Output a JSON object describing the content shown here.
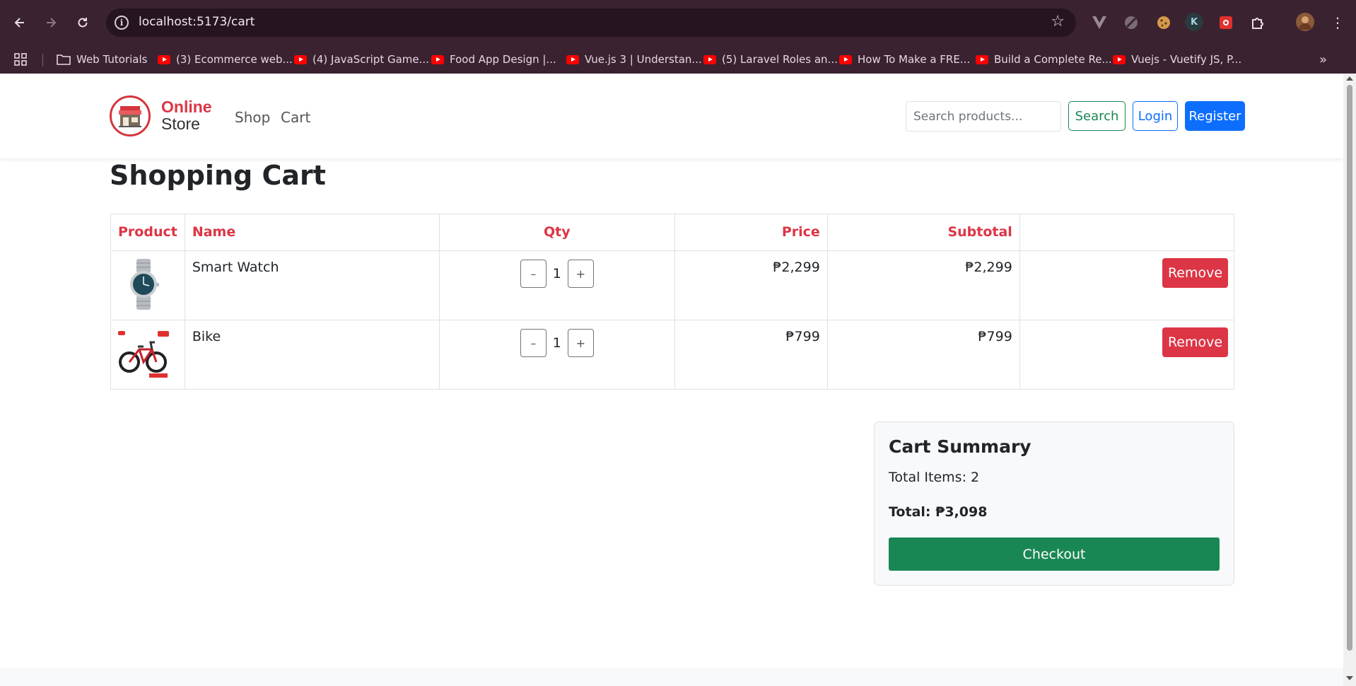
{
  "browser": {
    "url": "localhost:5173/cart",
    "bookmarks": [
      {
        "label": "Web Tutorials",
        "icon": "folder-icon"
      },
      {
        "label": "(3) Ecommerce web...",
        "icon": "youtube-icon"
      },
      {
        "label": "(4) JavaScript Game...",
        "icon": "youtube-icon"
      },
      {
        "label": "Food App Design |...",
        "icon": "youtube-icon"
      },
      {
        "label": "Vue.js 3 | Understan...",
        "icon": "youtube-icon"
      },
      {
        "label": "(5) Laravel Roles an...",
        "icon": "youtube-icon"
      },
      {
        "label": "How To Make a FRE...",
        "icon": "youtube-icon"
      },
      {
        "label": "Build a Complete Re...",
        "icon": "youtube-icon"
      },
      {
        "label": "Vuejs - Vuetify JS, P...",
        "icon": "youtube-icon"
      }
    ],
    "extension_k": "K"
  },
  "navbar": {
    "brand_line1": "Online",
    "brand_line2": "Store",
    "links": [
      "Shop",
      "Cart"
    ],
    "search_placeholder": "Search products...",
    "search_label": "Search",
    "login_label": "Login",
    "register_label": "Register"
  },
  "cart": {
    "title": "Shopping Cart",
    "columns": [
      "Product",
      "Name",
      "Qty",
      "Price",
      "Subtotal"
    ],
    "minus_label": "–",
    "plus_label": "+",
    "remove_label": "Remove",
    "items": [
      {
        "name": "Smart Watch",
        "qty": "1",
        "price": "₱2,299",
        "subtotal": "₱2,299",
        "image": "watch-image"
      },
      {
        "name": "Bike",
        "qty": "1",
        "price": "₱799",
        "subtotal": "₱799",
        "image": "bike-image"
      }
    ]
  },
  "summary": {
    "title": "Cart Summary",
    "total_items": "Total Items: 2",
    "total": "Total: ₱3,098",
    "checkout_label": "Checkout"
  },
  "colors": {
    "danger": "#dc3545",
    "primary": "#0d6efd",
    "success": "#198754",
    "chrome": "#3b2231"
  }
}
